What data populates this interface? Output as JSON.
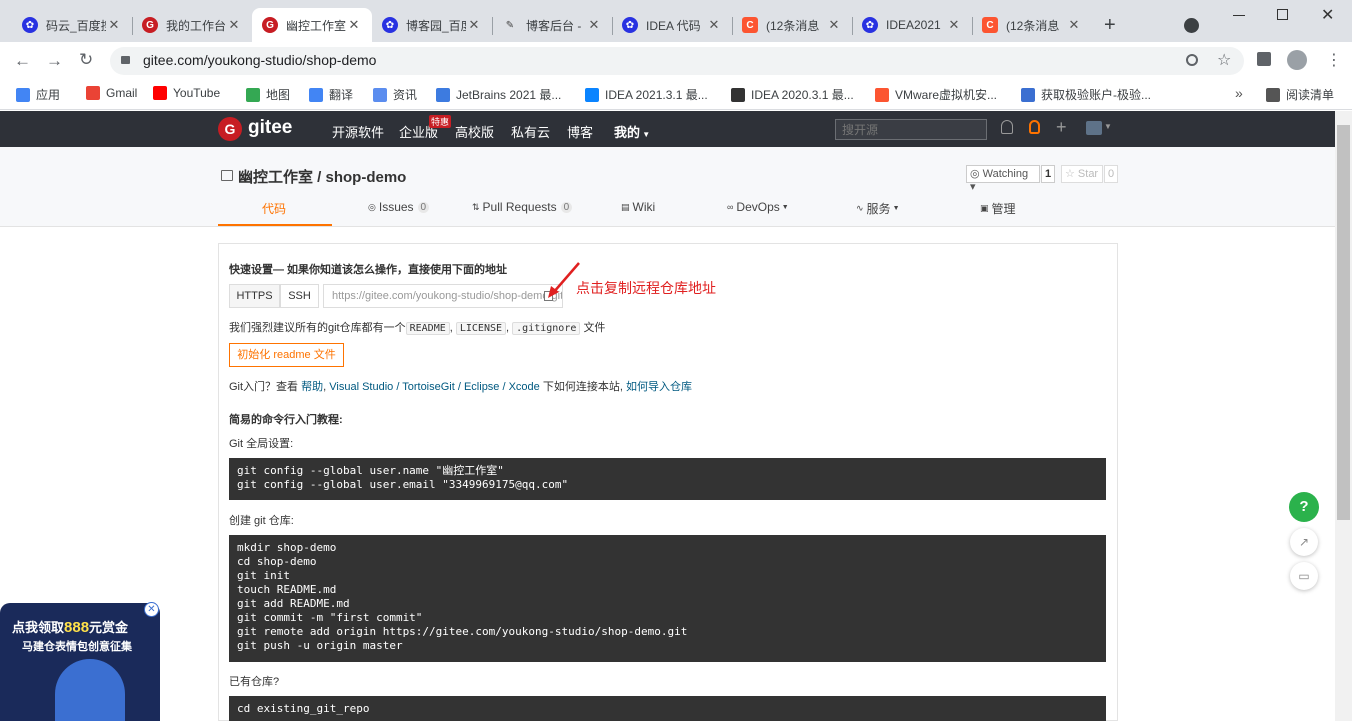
{
  "tabs": [
    {
      "label": "码云_百度搜",
      "icon": "baidu-paw"
    },
    {
      "label": "我的工作台",
      "icon": "gitee-logo"
    },
    {
      "label": "幽控工作室",
      "icon": "gitee-logo"
    },
    {
      "label": "博客园_百度",
      "icon": "baidu-paw"
    },
    {
      "label": "博客后台 -",
      "icon": "edit-icon"
    },
    {
      "label": "IDEA 代码",
      "icon": "baidu-paw"
    },
    {
      "label": "(12条消息",
      "icon": "csdn-logo"
    },
    {
      "label": "IDEA2021",
      "icon": "baidu-paw"
    },
    {
      "label": "(12条消息",
      "icon": "csdn-logo"
    }
  ],
  "address": {
    "url": "gitee.com/youkong-studio/shop-demo"
  },
  "bookmarks": [
    "应用",
    "Gmail",
    "YouTube",
    "地图",
    "翻译",
    "资讯",
    "JetBrains 2021 最...",
    "IDEA 2021.3.1 最...",
    "IDEA 2020.3.1 最...",
    "VMware虚拟机安...",
    "获取极验账户-极验...",
    "阅读清单"
  ],
  "gitee_nav": {
    "logo": "gitee",
    "items": [
      "开源软件",
      "企业版",
      "高校版",
      "私有云",
      "博客",
      "我的"
    ],
    "badge": "特惠",
    "search_placeholder": "搜开源"
  },
  "repo": {
    "title": "幽控工作室 / shop-demo",
    "watching": "Watching",
    "watch_count": "1",
    "star": "Star",
    "star_count": "0",
    "tabs": [
      {
        "label": "代码"
      },
      {
        "label": "Issues",
        "count": "0"
      },
      {
        "label": "Pull Requests",
        "count": "0"
      },
      {
        "label": "Wiki"
      },
      {
        "label": "DevOps"
      },
      {
        "label": "服务"
      },
      {
        "label": "管理"
      }
    ]
  },
  "quick": {
    "heading": "快速设置— 如果你知道该怎么操作，直接使用下面的地址",
    "https": "HTTPS",
    "ssh": "SSH",
    "clone_url": "https://gitee.com/youkong-studio/shop-demo.git",
    "annotation": "点击复制远程仓库地址",
    "suggest_prefix": "我们强烈建议所有的git仓库都有一个",
    "readme": "README",
    "license": "LICENSE",
    "gitignore": ".gitignore",
    "suggest_suffix": "文件",
    "init_button": "初始化 readme 文件",
    "help_prefix": "Git入门？查看 ",
    "help": "帮助",
    "tools": "Visual Studio / TortoiseGit / Eclipse / Xcode",
    "help_mid": " 下如何连接本站, ",
    "import": "如何导入仓库"
  },
  "tutorial": {
    "heading": "简易的命令行入门教程:",
    "global_label": "Git 全局设置:",
    "global_code": "git config --global user.name \"幽控工作室\"\ngit config --global user.email \"3349969175@qq.com\"",
    "create_label": "创建 git 仓库:",
    "create_code": "mkdir shop-demo\ncd shop-demo\ngit init\ntouch README.md\ngit add README.md\ngit commit -m \"first commit\"\ngit remote add origin https://gitee.com/youkong-studio/shop-demo.git\ngit push -u origin master",
    "existing_label": "已有仓库?",
    "existing_code": "cd existing_git_repo"
  },
  "promo": {
    "line1": "点我领取",
    "amount": "888",
    "line1b": "元赏金",
    "line2": "马建仓表情包创意征集"
  }
}
